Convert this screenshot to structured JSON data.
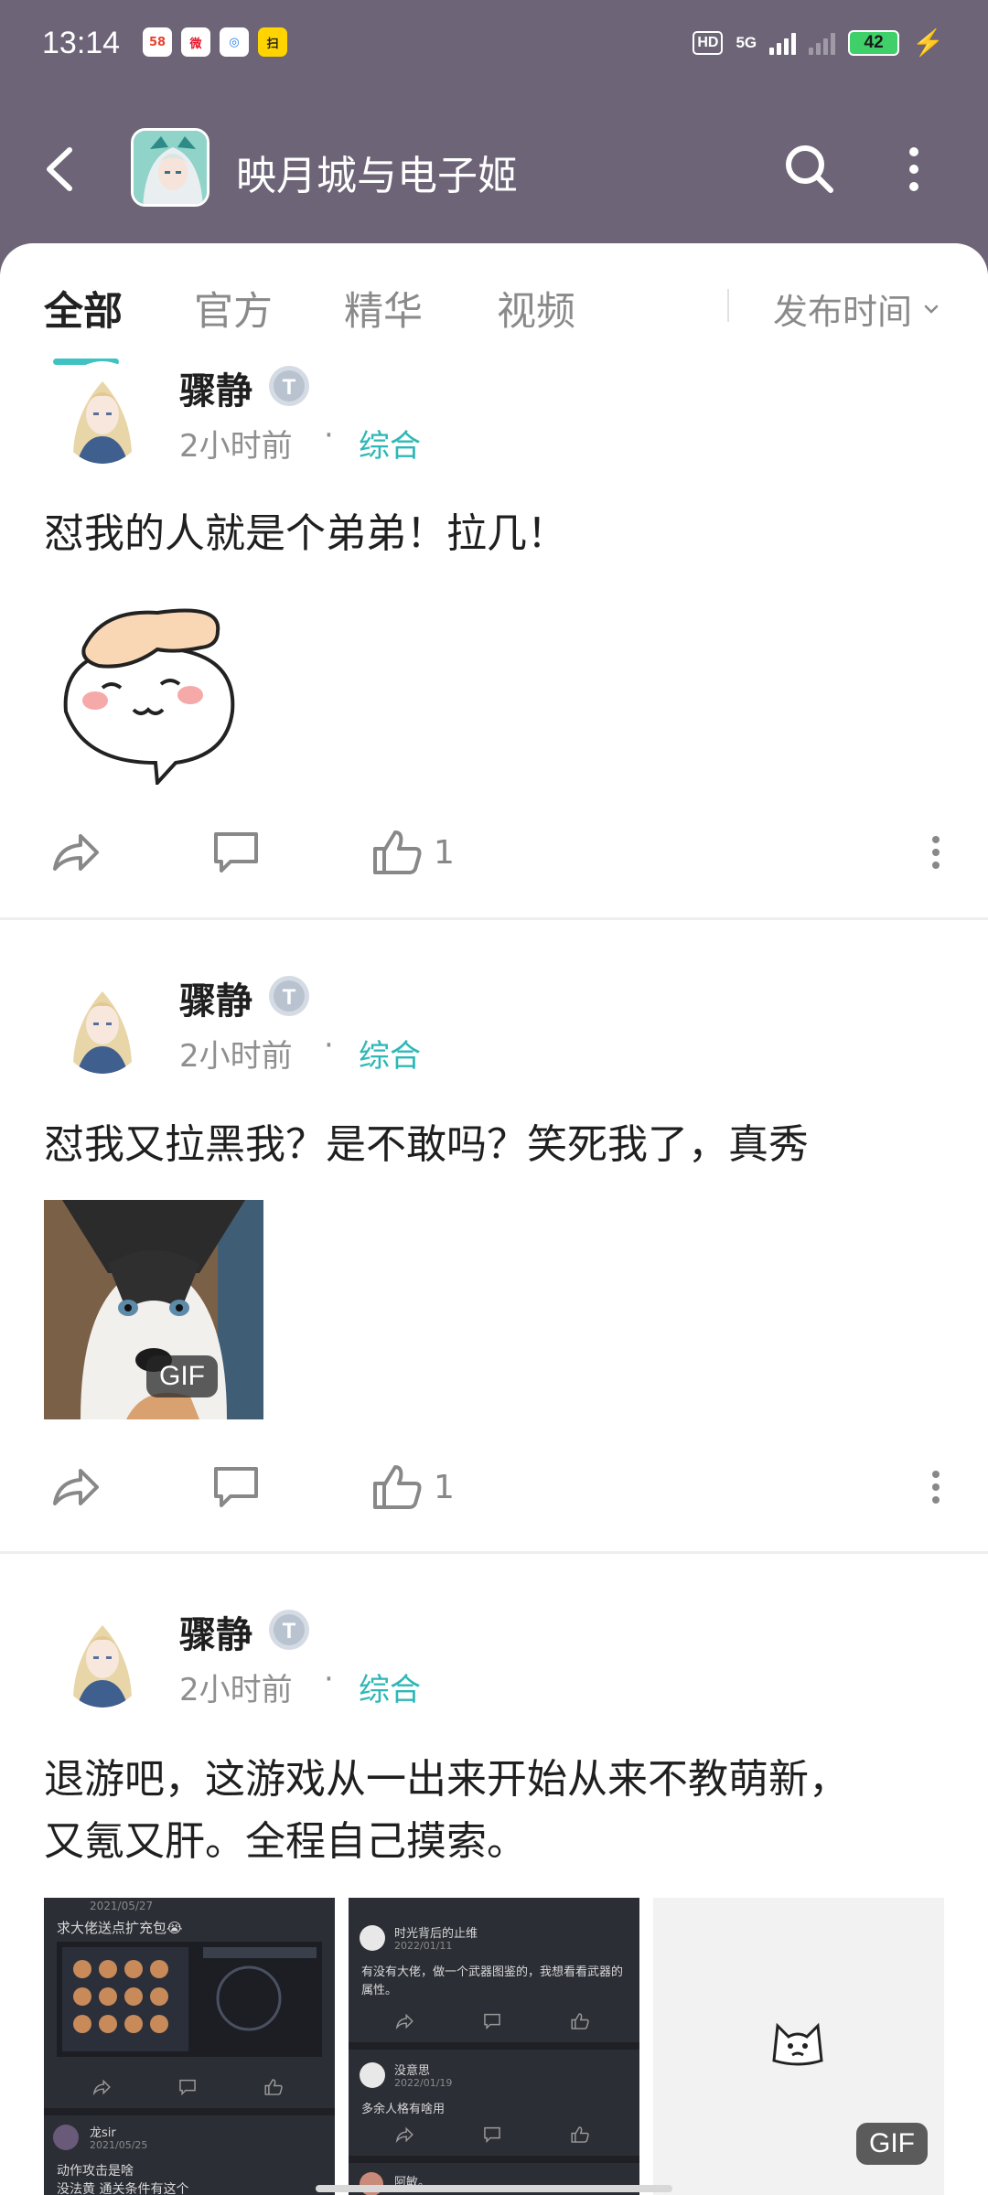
{
  "status_bar": {
    "time": "13:14",
    "app_icons": [
      "58",
      "微",
      "◎",
      "扫"
    ],
    "hd": "HD",
    "network": "5G",
    "battery": "42"
  },
  "header": {
    "title": "映月城与电子姬",
    "colors": {
      "background": "#6d6577",
      "accent": "#3fc2c2"
    }
  },
  "tabs": [
    {
      "label": "全部",
      "active": true
    },
    {
      "label": "官方",
      "active": false
    },
    {
      "label": "精华",
      "active": false
    },
    {
      "label": "视频",
      "active": false
    }
  ],
  "sort": {
    "label": "发布时间"
  },
  "posts": [
    {
      "author": "骤静",
      "level": "T",
      "time": "2小时前",
      "category": "综合",
      "content": "怼我的人就是个弟弟！拉几！",
      "likes": "1"
    },
    {
      "author": "骤静",
      "level": "T",
      "time": "2小时前",
      "category": "综合",
      "content": "怼我又拉黑我？是不敢吗？笑死我了，真秀",
      "image_badge": "GIF",
      "likes": "1"
    },
    {
      "author": "骤静",
      "level": "T",
      "time": "2小时前",
      "category": "综合",
      "content_line1": "退游吧，这游戏从一出来开始从来不教萌新，",
      "content_line2": "又氪又肝。全程自己摸索。",
      "image_badge": "GIF"
    }
  ],
  "thumbnails": {
    "first": {
      "date1": "2021/05/27",
      "text1": "求大佬送点扩充包😭",
      "user2": "龙sir",
      "date2": "2021/05/25",
      "text2": "动作攻击是啥",
      "text3": "没法黄 通关条件有这个"
    },
    "second": {
      "user1": "时光背后的止维",
      "date1": "2022/01/11",
      "text1": "有没有大佬，做一个武器图鉴的，我想看看武器的属性。",
      "user2": "没意思",
      "date2": "2022/01/19",
      "text2": "多余人格有啥用",
      "user3": "阿敏。"
    }
  }
}
